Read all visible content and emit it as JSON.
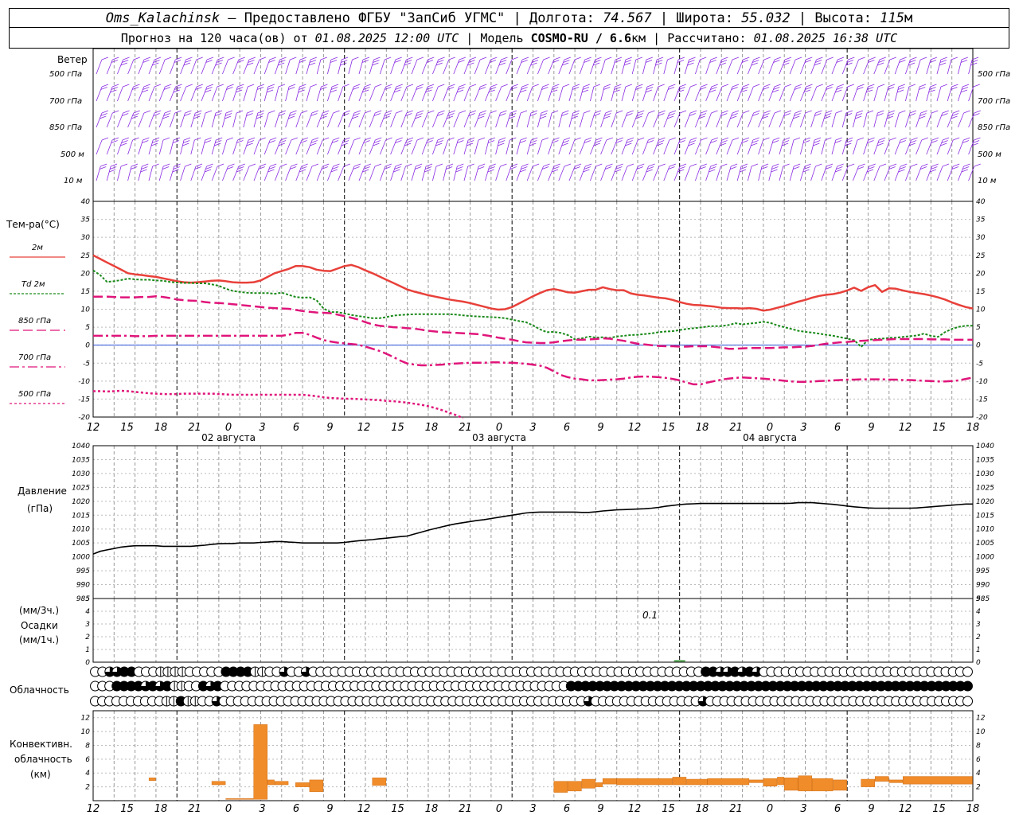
{
  "header": {
    "station": "Oms_Kalachinsk",
    "dash": " — ",
    "provided_by": "Предоставлено ФГБУ \"ЗапСиб УГМС\"",
    "lon_label": "Долгота:",
    "lon": "74.567",
    "lat_label": "Широта:",
    "lat": "55.032",
    "alt_label": "Высота:",
    "alt": "115",
    "alt_unit": "м",
    "forecast_label": "Прогноз на 120 часа(ов) от",
    "forecast_time": "01.08.2025 12:00 UTC",
    "model_label": "Модель",
    "model": "COSMO-RU / 6.6",
    "model_unit": "км",
    "calc_label": "Рассчитано:",
    "calc_time": "01.08.2025 16:38 UTC"
  },
  "wind": {
    "title": "Ветер",
    "levels": [
      "500 гПа",
      "700 гПа",
      "850 гПа",
      "500 м",
      "10  м"
    ]
  },
  "temp": {
    "title": "Тем-ра(°С)",
    "legend": [
      {
        "label": "2м",
        "color": "#e8403a"
      },
      {
        "label": "Td  2м",
        "color": "#1a8a1a"
      },
      {
        "label": "850 гПа",
        "color": "#e0157a"
      },
      {
        "label": "700 гПа",
        "color": "#e0157a"
      },
      {
        "label": "500 гПа",
        "color": "#e0157a"
      }
    ]
  },
  "pressure": {
    "title": "Давление",
    "unit": "(гПа)"
  },
  "precip": {
    "unit_3h": "(мм/3ч.)",
    "title": "Осадки",
    "unit_1h": "(мм/1ч.)",
    "label_value": "0.1"
  },
  "clouds": {
    "title": "Облачность"
  },
  "conv": {
    "title1": "Конвективн.",
    "title2": "облачность",
    "unit": "(км)"
  },
  "colors": {
    "wind": "#8a2be2",
    "t2m": "#e8403a",
    "td": "#1a8a1a",
    "upper": "#e0157a",
    "pressure": "#000000",
    "conv": "#f08c2a",
    "zero": "#2a4fd6"
  },
  "chart_data": [
    {
      "type": "line",
      "name": "temperature",
      "x_hours": [
        0,
        1,
        2,
        3,
        4,
        5,
        6,
        7,
        8,
        9,
        10,
        11,
        12,
        13,
        14,
        15,
        16,
        17,
        18,
        19,
        20,
        21,
        22,
        23,
        24,
        25,
        26,
        27,
        28,
        29,
        30,
        31,
        32,
        33,
        34,
        35,
        36,
        37,
        38,
        39,
        40,
        41,
        42,
        43,
        44,
        45,
        46,
        47,
        48,
        49,
        50,
        51,
        52,
        53,
        54,
        55,
        56,
        57,
        58,
        59,
        60,
        61,
        62,
        63,
        64,
        65,
        66,
        67,
        68,
        69,
        70,
        71,
        72,
        73,
        74,
        75,
        76,
        77,
        78,
        79,
        80,
        81,
        82,
        83,
        84,
        85,
        86,
        87,
        88,
        89,
        90,
        91,
        92,
        93,
        94,
        95,
        96,
        97,
        98,
        99,
        100,
        101,
        102,
        103,
        104,
        105,
        106,
        107,
        108,
        109,
        110,
        111,
        112,
        113,
        114,
        115,
        116,
        117,
        118,
        119,
        120,
        121,
        122,
        123,
        124,
        125,
        126
      ],
      "ylim": [
        -20,
        40
      ],
      "yticks": [
        -20,
        -15,
        -10,
        -5,
        0,
        5,
        10,
        15,
        20,
        25,
        30,
        35,
        40
      ],
      "series": [
        {
          "name": "2м",
          "values": [
            25,
            24,
            23,
            22,
            21,
            20,
            19.7,
            19.5,
            19.2,
            19,
            18.6,
            18.2,
            17.8,
            17.5,
            17.4,
            17.5,
            17.7,
            17.9,
            18,
            17.8,
            17.5,
            17.4,
            17.4,
            17.5,
            18,
            19,
            20,
            20.6,
            21.2,
            22,
            22,
            21.7,
            21,
            20.7,
            20.6,
            21.3,
            22,
            22.3,
            21.7,
            20.8,
            20,
            19.1,
            18.2,
            17.3,
            16.4,
            15.5,
            14.9,
            14.4,
            13.9,
            13.5,
            13.1,
            12.7,
            12.4,
            12.1,
            11.7,
            11.2,
            10.7,
            10.2,
            9.9,
            10,
            10.6,
            11.6,
            12.6,
            13.6,
            14.5,
            15.3,
            15.6,
            15.2,
            14.7,
            14.6,
            15,
            15.4,
            15.4,
            16.1,
            15.6,
            15.3,
            15.3,
            14.4,
            14,
            13.8,
            13.5,
            13.2,
            13,
            12.6,
            12,
            11.5,
            11.2,
            11.1,
            10.9,
            10.7,
            10.4,
            10.3,
            10.3,
            10.2,
            10.3,
            10.1,
            9.6,
            9.9,
            10.4,
            10.9,
            11.5,
            12.1,
            12.6,
            13.2,
            13.7,
            14,
            14.2,
            14.6,
            15.2,
            16,
            15.1,
            16.1,
            16.7,
            14.8,
            15.8,
            15.7,
            15.2,
            14.8,
            14.5,
            14.2,
            13.8,
            13.3,
            12.7,
            11.9,
            11.2,
            10.6,
            10.2
          ]
        },
        {
          "name": "Td  2м",
          "values": [
            20.8,
            19.5,
            17.6,
            17.8,
            18.1,
            18.5,
            18.3,
            18.2,
            18.2,
            18,
            17.9,
            17.6,
            17.4,
            17.3,
            17.3,
            17.2,
            17.2,
            16.9,
            16.5,
            15.7,
            15.1,
            14.8,
            14.6,
            14.5,
            14.5,
            14.5,
            14.3,
            14.6,
            14,
            13.4,
            13.2,
            13.3,
            12.5,
            10.2,
            9.2,
            9.2,
            8.8,
            8.4,
            8.1,
            7.8,
            7.5,
            7.5,
            7.8,
            8.2,
            8.4,
            8.5,
            8.6,
            8.6,
            8.6,
            8.6,
            8.6,
            8.6,
            8.5,
            8.3,
            8.1,
            8,
            7.9,
            7.8,
            7.7,
            7.5,
            7.1,
            6.7,
            6.4,
            5.5,
            4.4,
            3.6,
            3.7,
            3.4,
            2.8,
            1.6,
            1.9,
            2.4,
            2.1,
            2.2,
            2,
            2.4,
            2.6,
            2.8,
            2.9,
            3.1,
            3.3,
            3.6,
            3.8,
            3.9,
            4.2,
            4.5,
            4.7,
            4.9,
            5.2,
            5.3,
            5.3,
            5.6,
            6.1,
            5.8,
            6,
            6.2,
            6.5,
            6.2,
            5.5,
            5,
            4.5,
            4,
            3.7,
            3.5,
            3.2,
            2.9,
            2.6,
            2.2,
            1.8,
            1.4,
            -0.5,
            1.5,
            1.7,
            1.8,
            2,
            2.1,
            2.3,
            2.5,
            2.7,
            3.2,
            2.6,
            2.3,
            3.6,
            4.5,
            5.1,
            5.4,
            5.4
          ]
        },
        {
          "name": "850 гПа",
          "values": [
            13.5,
            13.5,
            13.5,
            13.4,
            13.3,
            13.3,
            13.3,
            13.4,
            13.4,
            13.6,
            13.4,
            13.1,
            12.7,
            12.5,
            12.4,
            12.3,
            12,
            11.8,
            11.7,
            11.6,
            11.4,
            11.2,
            11,
            10.8,
            10.6,
            10.4,
            10.3,
            10.2,
            10.1,
            9.8,
            9.5,
            9.3,
            9.1,
            9,
            8.9,
            8.5,
            8.1,
            7.6,
            7.1,
            6.4,
            5.8,
            5.4,
            5.2,
            5,
            4.9,
            4.7,
            4.6,
            4.3,
            4,
            3.8,
            3.6,
            3.5,
            3.4,
            3.3,
            3.2,
            3.1,
            2.8,
            2.5,
            2.1,
            1.8,
            1.5,
            1.1,
            0.8,
            0.7,
            0.6,
            0.6,
            0.8,
            1.1,
            1.3,
            1.5,
            1.5,
            1.6,
            1.7,
            1.9,
            1.8,
            1.5,
            1.2,
            0.8,
            0.4,
            0.2,
            0,
            -0.2,
            -0.3,
            -0.3,
            -0.4,
            -0.4,
            -0.3,
            -0.3,
            -0.3,
            -0.5,
            -0.7,
            -1,
            -1,
            -0.9,
            -0.8,
            -0.8,
            -0.8,
            -0.8,
            -0.7,
            -0.6,
            -0.6,
            -0.5,
            -0.4,
            -0.2,
            0.1,
            0.4,
            0.6,
            0.8,
            0.9,
            1.1,
            1.2,
            1.3,
            1.4,
            1.5,
            1.6,
            1.7,
            1.7,
            1.7,
            1.7,
            1.7,
            1.6,
            1.6,
            1.6,
            1.5,
            1.5,
            1.5,
            1.5
          ]
        },
        {
          "name": "700 гПа",
          "values": [
            2.6,
            2.6,
            2.6,
            2.6,
            2.6,
            2.6,
            2.5,
            2.5,
            2.5,
            2.6,
            2.6,
            2.6,
            2.6,
            2.6,
            2.6,
            2.6,
            2.6,
            2.6,
            2.6,
            2.6,
            2.6,
            2.6,
            2.6,
            2.6,
            2.6,
            2.6,
            2.6,
            2.6,
            2.9,
            3.4,
            3.4,
            2.9,
            2.1,
            1.4,
            1,
            0.7,
            0.5,
            0.3,
            0.1,
            -0.4,
            -1,
            -1.6,
            -2.4,
            -3.3,
            -4.3,
            -5.1,
            -5.4,
            -5.6,
            -5.6,
            -5.5,
            -5.4,
            -5.2,
            -5.1,
            -5,
            -4.9,
            -4.9,
            -4.9,
            -4.8,
            -4.8,
            -4.9,
            -4.9,
            -5,
            -5.2,
            -5.4,
            -5.7,
            -6.3,
            -7.3,
            -8.3,
            -8.9,
            -9.3,
            -9.5,
            -9.8,
            -9.8,
            -9.7,
            -9.6,
            -9.5,
            -9.3,
            -9,
            -8.8,
            -8.7,
            -8.8,
            -8.9,
            -9.1,
            -9.4,
            -9.8,
            -10.4,
            -10.9,
            -10.9,
            -10.4,
            -10,
            -9.6,
            -9.3,
            -9.1,
            -9,
            -9.1,
            -9.2,
            -9.3,
            -9.5,
            -9.7,
            -9.9,
            -10.1,
            -10.2,
            -10.2,
            -10.1,
            -10,
            -9.9,
            -9.8,
            -9.7,
            -9.6,
            -9.6,
            -9.5,
            -9.5,
            -9.5,
            -9.5,
            -9.6,
            -9.6,
            -9.7,
            -9.7,
            -9.8,
            -9.9,
            -10,
            -10.1,
            -10.1,
            -10,
            -9.8,
            -9.4,
            -9
          ]
        },
        {
          "name": "500 гПа",
          "values": [
            -12.8,
            -12.8,
            -12.9,
            -12.8,
            -12.7,
            -12.8,
            -13,
            -13.2,
            -13.4,
            -13.5,
            -13.6,
            -13.6,
            -13.6,
            -13.5,
            -13.5,
            -13.5,
            -13.5,
            -13.5,
            -13.6,
            -13.7,
            -13.8,
            -13.8,
            -13.8,
            -13.8,
            -13.8,
            -13.8,
            -13.8,
            -13.8,
            -13.8,
            -13.8,
            -13.8,
            -14,
            -14.2,
            -14.5,
            -14.7,
            -14.8,
            -14.9,
            -14.9,
            -15,
            -15.1,
            -15.2,
            -15.3,
            -15.5,
            -15.6,
            -15.8,
            -16,
            -16.3,
            -16.6,
            -17,
            -17.5,
            -18.1,
            -18.8,
            -19.5,
            -20.3
          ]
        }
      ]
    },
    {
      "type": "line",
      "name": "pressure",
      "ylim": [
        985,
        1040
      ],
      "yticks": [
        985,
        990,
        995,
        1000,
        1005,
        1010,
        1015,
        1020,
        1025,
        1030,
        1035,
        1040
      ],
      "values": [
        1001,
        1002,
        1002.5,
        1003,
        1003.5,
        1003.8,
        1004,
        1004,
        1004,
        1004,
        1003.8,
        1003.8,
        1003.8,
        1003.8,
        1003.8,
        1004,
        1004.2,
        1004.5,
        1004.7,
        1004.8,
        1004.8,
        1005,
        1005,
        1005,
        1005.2,
        1005.3,
        1005.5,
        1005.5,
        1005.3,
        1005.2,
        1005,
        1005,
        1005,
        1005,
        1005,
        1005,
        1005.2,
        1005.5,
        1005.8,
        1006,
        1006.2,
        1006.5,
        1006.7,
        1007,
        1007.3,
        1007.5,
        1008.2,
        1008.9,
        1009.6,
        1010.2,
        1010.8,
        1011.4,
        1011.9,
        1012.3,
        1012.7,
        1013.1,
        1013.4,
        1013.8,
        1014.2,
        1014.6,
        1015,
        1015.4,
        1015.8,
        1016,
        1016.1,
        1016.1,
        1016.1,
        1016.1,
        1016.1,
        1016.1,
        1016,
        1016,
        1016.2,
        1016.5,
        1016.7,
        1016.9,
        1017,
        1017.1,
        1017.2,
        1017.3,
        1017.5,
        1017.8,
        1018.2,
        1018.5,
        1018.8,
        1019,
        1019.1,
        1019.2,
        1019.2,
        1019.2,
        1019.2,
        1019.2,
        1019.2,
        1019.2,
        1019.2,
        1019.2,
        1019.2,
        1019.2,
        1019.2,
        1019.2,
        1019.3,
        1019.5,
        1019.5,
        1019.5,
        1019.3,
        1019.1,
        1018.9,
        1018.6,
        1018.3,
        1018,
        1017.8,
        1017.6,
        1017.5,
        1017.5,
        1017.5,
        1017.5,
        1017.5,
        1017.5,
        1017.6,
        1017.8,
        1018,
        1018.2,
        1018.4,
        1018.6,
        1018.8,
        1019,
        1019
      ]
    },
    {
      "type": "bar",
      "name": "precipitation",
      "ylim": [
        0,
        5
      ],
      "yticks": [
        0,
        1,
        2,
        3,
        4,
        5
      ],
      "values": [
        {
          "hour": 84,
          "mm": 0.1
        }
      ]
    },
    {
      "type": "bar",
      "name": "convective_cloud",
      "ylim": [
        0,
        13
      ],
      "yticks": [
        2,
        4,
        6,
        8,
        10,
        12
      ],
      "bars": [
        [
          8,
          9,
          2.9,
          3.3
        ],
        [
          17,
          19,
          2.3,
          2.8
        ],
        [
          19,
          23,
          0.2,
          0.3
        ],
        [
          23,
          25,
          0.2,
          11
        ],
        [
          25,
          26,
          2.3,
          3
        ],
        [
          26,
          28,
          2.3,
          2.8
        ],
        [
          29,
          31,
          2,
          2.6
        ],
        [
          31,
          33,
          1.3,
          3
        ],
        [
          40,
          42,
          2.2,
          3.3
        ],
        [
          66,
          68,
          1.2,
          2.8
        ],
        [
          68,
          70,
          1.4,
          2.8
        ],
        [
          70,
          72,
          1.8,
          3.1
        ],
        [
          72,
          73,
          2,
          2.6
        ],
        [
          73,
          75,
          2.4,
          3.2
        ],
        [
          75,
          83,
          2.3,
          3.2
        ],
        [
          83,
          85,
          2.3,
          3.4
        ],
        [
          85,
          88,
          2.3,
          3.1
        ],
        [
          88,
          94,
          2.3,
          3.2
        ],
        [
          94,
          96,
          2.6,
          3
        ],
        [
          96,
          98,
          2.1,
          3.2
        ],
        [
          98,
          99,
          2.3,
          3.4
        ],
        [
          99,
          101,
          1.5,
          3.3
        ],
        [
          101,
          103,
          1.4,
          3.6
        ],
        [
          103,
          106,
          1.4,
          3.2
        ],
        [
          106,
          108,
          1.5,
          3
        ],
        [
          110,
          112,
          2,
          3.1
        ],
        [
          112,
          114,
          2.8,
          3.5
        ],
        [
          114,
          116,
          2.6,
          3
        ],
        [
          116,
          126,
          2.4,
          3.5
        ]
      ]
    },
    {
      "type": "table",
      "name": "cloudiness",
      "rows": [
        "aaddffaaabbbbaaaaaffffbbaadaadaaaaaaaaaaaaaaaaaaaaaaaaaaaaaaaaaaaaaaaaaaaaaaaaaaaaaaffddfdfdaaaaaaaaaaaaaaaaaaaaaaaaaaaaa",
        "aaaffffdfdfbbaafdfaaaaaaaaaaaaaaaaaaaaaaaaaaaaaaaaaaaaaaaaaaaaaaaaffffffffffffffffffffffffffffffffffffffffffffffffffffffff",
        "aaaaaaaaaabbfbbaadaaaaaaaaaaaaaaaaaaaaaaaaaaaaaaaaaaaaaaaaaaaaaaaaaaadaaaaaaaaaaaaaaadaaaaaaaaaaaaaaaaaaaaaaaaaaaaaaaaaaaaa"
      ]
    },
    {
      "type": "table",
      "name": "time_axis",
      "tick_labels": [
        "12",
        "15",
        "18",
        "21",
        "0",
        "3",
        "6",
        "9",
        "12",
        "15",
        "18",
        "21",
        "0",
        "3",
        "6",
        "9",
        "12",
        "15",
        "18",
        "21",
        "0",
        "3",
        "6",
        "9",
        "12",
        "15",
        "18"
      ],
      "day_labels": [
        "02 августа",
        "03 августа",
        "04 августа"
      ]
    }
  ]
}
